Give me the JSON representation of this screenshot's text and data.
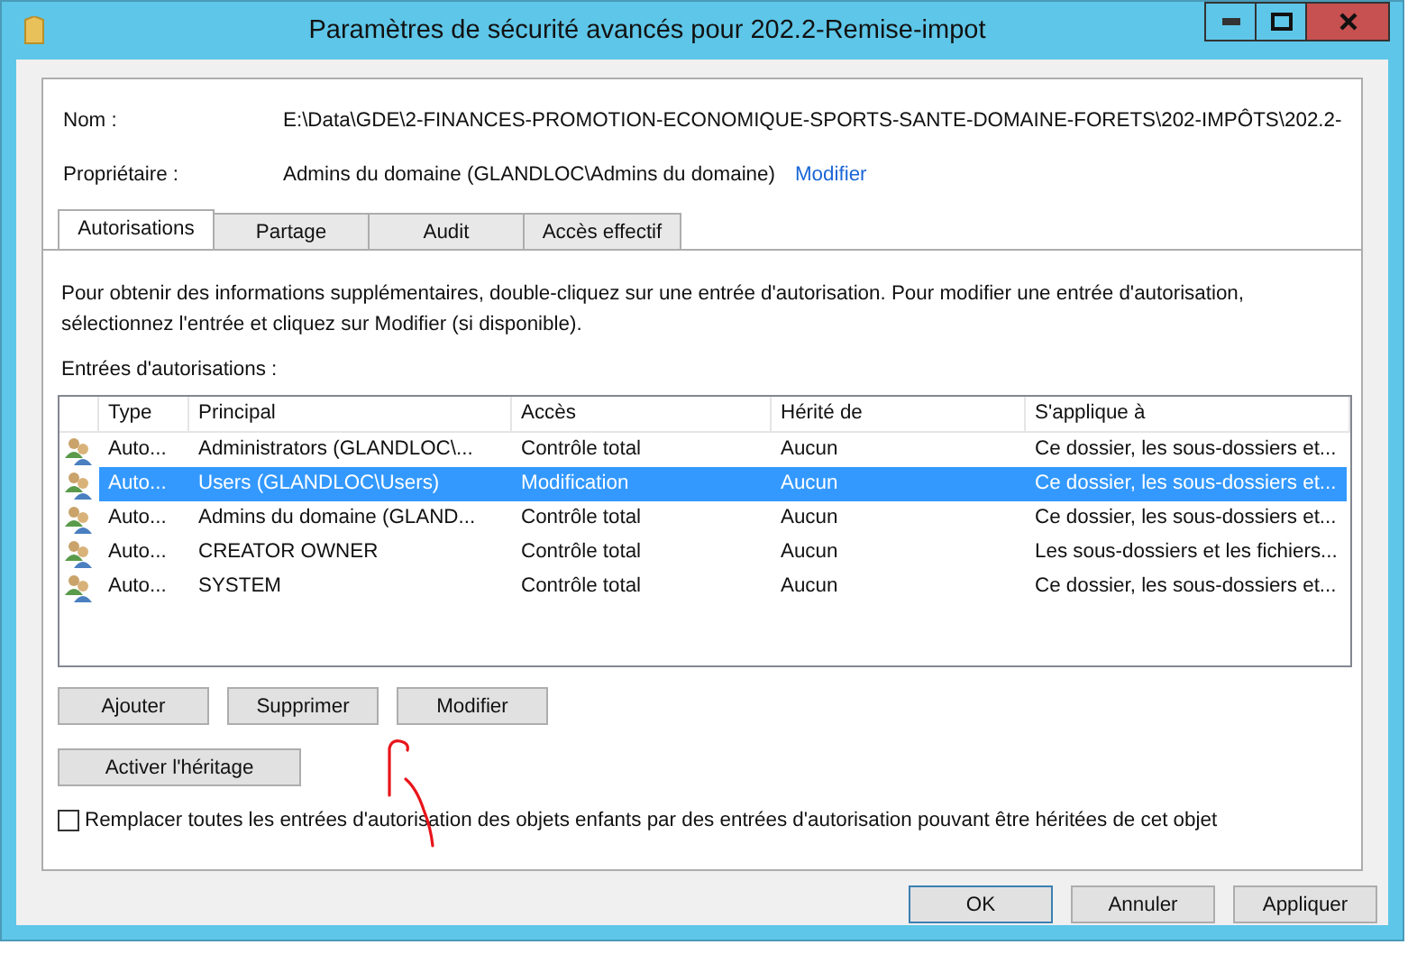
{
  "window": {
    "title": "Paramètres de sécurité avancés pour 202.2-Remise-impot"
  },
  "name": {
    "label": "Nom :",
    "value": "E:\\Data\\GDE\\2-FINANCES-PROMOTION-ECONOMIQUE-SPORTS-SANTE-DOMAINE-FORETS\\202-IMPÔTS\\202.2-"
  },
  "owner": {
    "label": "Propriétaire :",
    "value": "Admins du domaine (GLANDLOC\\Admins du domaine)",
    "link": "Modifier"
  },
  "tabs": [
    {
      "label": "Autorisations",
      "selected": true
    },
    {
      "label": "Partage",
      "selected": false
    },
    {
      "label": "Audit",
      "selected": false
    },
    {
      "label": "Accès effectif",
      "selected": false
    }
  ],
  "description": "Pour obtenir des informations supplémentaires, double-cliquez sur une entrée d'autorisation. Pour modifier une entrée d'autorisation, sélectionnez l'entrée et cliquez sur Modifier (si disponible).",
  "entries_label": "Entrées d'autorisations :",
  "table": {
    "columns": [
      "Type",
      "Principal",
      "Accès",
      "Hérité de",
      "S'applique à"
    ],
    "rows": [
      {
        "cells": [
          "Auto...",
          "Administrators (GLANDLOC\\...",
          "Contrôle total",
          "Aucun",
          "Ce dossier, les sous-dossiers et..."
        ],
        "selected": false
      },
      {
        "cells": [
          "Auto...",
          "Users (GLANDLOC\\Users)",
          "Modification",
          "Aucun",
          "Ce dossier, les sous-dossiers et..."
        ],
        "selected": true
      },
      {
        "cells": [
          "Auto...",
          "Admins du domaine (GLAND...",
          "Contrôle total",
          "Aucun",
          "Ce dossier, les sous-dossiers et..."
        ],
        "selected": false
      },
      {
        "cells": [
          "Auto...",
          "CREATOR OWNER",
          "Contrôle total",
          "Aucun",
          "Les sous-dossiers et les fichiers..."
        ],
        "selected": false
      },
      {
        "cells": [
          "Auto...",
          "SYSTEM",
          "Contrôle total",
          "Aucun",
          "Ce dossier, les sous-dossiers et..."
        ],
        "selected": false
      }
    ]
  },
  "entry_buttons": [
    "Ajouter",
    "Supprimer",
    "Modifier"
  ],
  "inherit_button": "Activer l'héritage",
  "replace_checkbox": {
    "label": "Remplacer toutes les entrées d'autorisation des objets enfants par des entrées d'autorisation pouvant être héritées de cet objet",
    "checked": false
  },
  "footer_buttons": [
    "OK",
    "Annuler",
    "Appliquer"
  ]
}
